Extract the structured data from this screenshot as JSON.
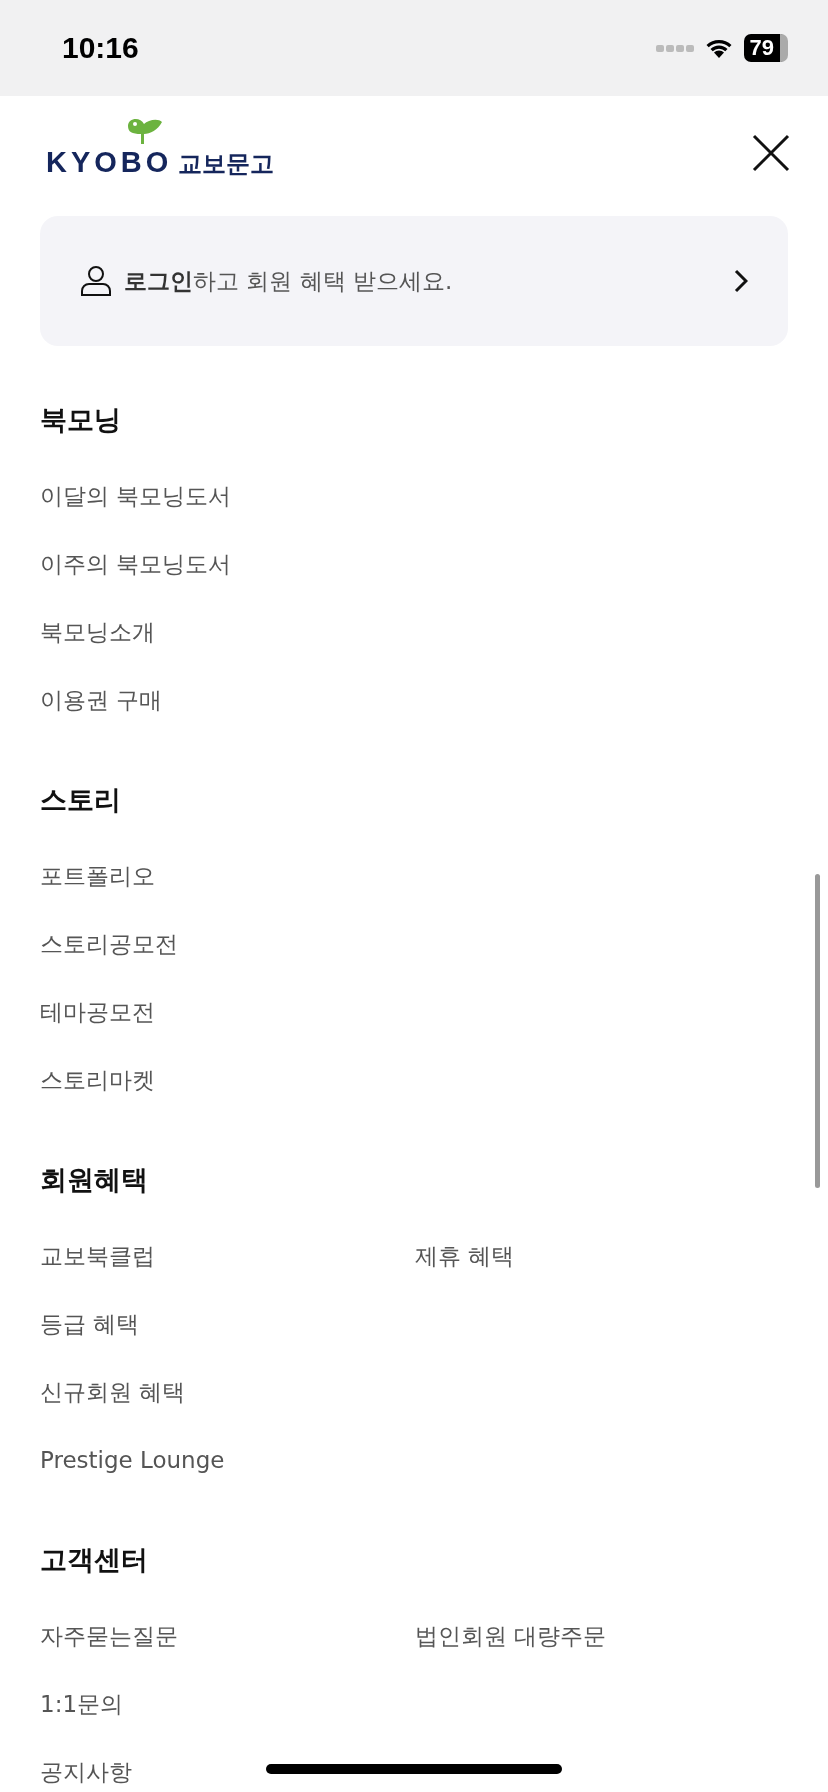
{
  "status_bar": {
    "time": "10:16",
    "battery": "79"
  },
  "logo": {
    "latin": "KYOBO",
    "korean": "교보문고"
  },
  "login_banner": {
    "text": "**로그인**하고 회원 혜택 받으세요."
  },
  "sections": [
    {
      "title": "북모닝",
      "rows": [
        [
          "이달의 북모닝도서"
        ],
        [
          "이주의 북모닝도서"
        ],
        [
          "북모닝소개"
        ],
        [
          "이용권 구매"
        ]
      ]
    },
    {
      "title": "스토리",
      "rows": [
        [
          "포트폴리오"
        ],
        [
          "스토리공모전"
        ],
        [
          "테마공모전"
        ],
        [
          "스토리마켓"
        ]
      ]
    },
    {
      "title": "회원혜택",
      "rows": [
        [
          "교보북클럽",
          "제휴 혜택"
        ],
        [
          "등급 혜택"
        ],
        [
          "신규회원 혜택"
        ],
        [
          "Prestige Lounge"
        ]
      ]
    },
    {
      "title": "고객센터",
      "rows": [
        [
          "자주묻는질문",
          "법인회원 대량주문"
        ],
        [
          "1:1문의"
        ],
        [
          "공지사항"
        ]
      ]
    }
  ]
}
